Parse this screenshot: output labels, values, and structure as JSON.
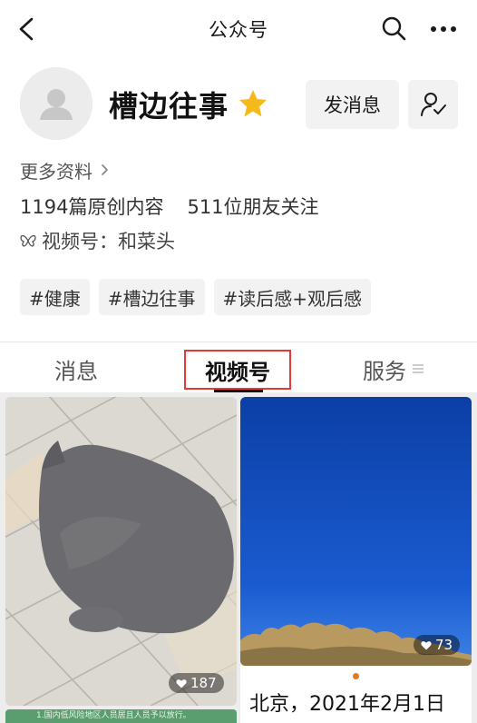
{
  "header": {
    "title": "公众号",
    "back_icon": "chevron-left-icon",
    "search_icon": "search-icon",
    "more_icon": "more-dots-icon"
  },
  "profile": {
    "name": "槽边往事",
    "badge_icon": "star-icon",
    "message_button": "发消息",
    "follow_icon": "person-check-icon",
    "more_info": "更多资料",
    "stats": {
      "articles": "1194篇原创内容",
      "friends": "511位朋友关注"
    },
    "channel": "视频号：和菜头",
    "tags": [
      "#健康",
      "#槽边往事",
      "#读后感+观后感"
    ]
  },
  "tabs": [
    "消息",
    "视频号",
    "服务"
  ],
  "videos": [
    {
      "likes": "187",
      "strip_text": "1.国内低风险地区人员居且人员予以放行。"
    },
    {
      "likes": "73",
      "caption": "北京，2021年2月1日"
    }
  ],
  "colors": {
    "highlight_border": "#e53935",
    "star": "#f5b91c",
    "sky": "#0a46b8"
  }
}
